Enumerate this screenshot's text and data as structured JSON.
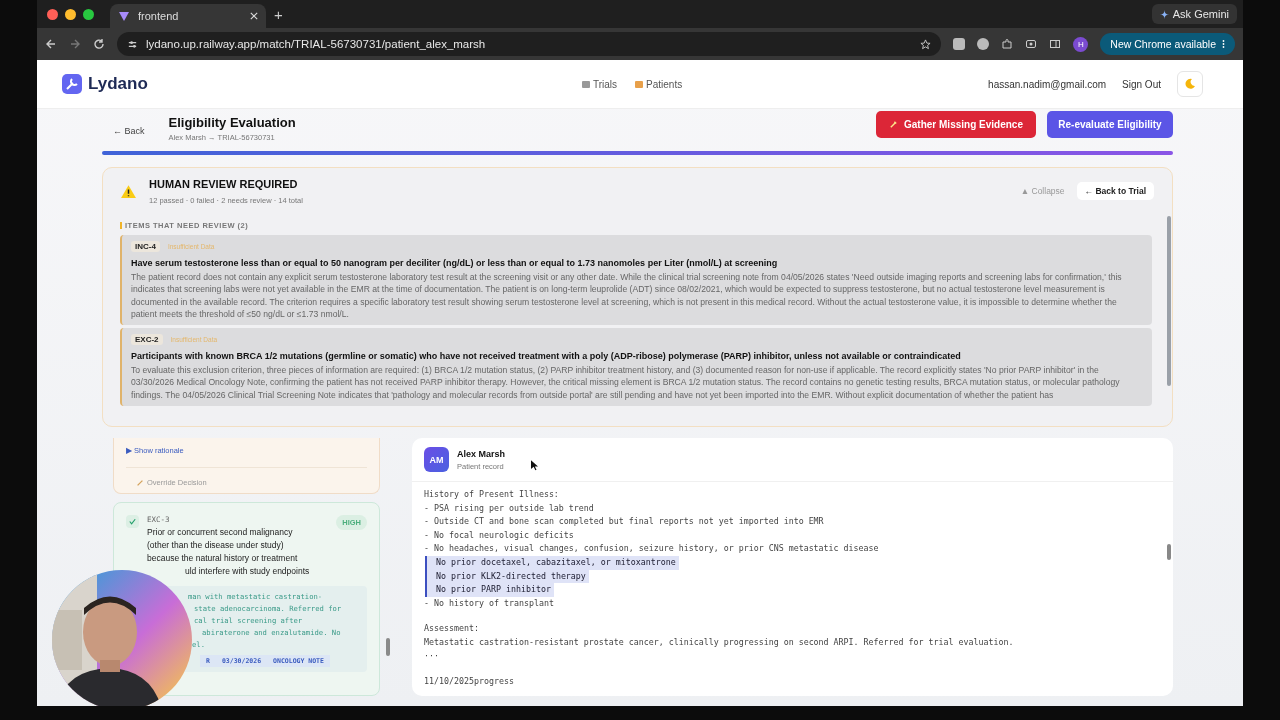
{
  "browser": {
    "tab": {
      "title": "frontend",
      "selected": true
    },
    "new_tab": "+",
    "ask_gemini": "Ask Gemini",
    "url": "lydano.up.railway.app/match/TRIAL-56730731/patient_alex_marsh",
    "profile": "H",
    "update_button": "New Chrome available"
  },
  "header": {
    "logo": "Lydano",
    "nav": [
      {
        "label": "Trials"
      },
      {
        "label": "Patients"
      }
    ],
    "email": "hassan.nadim@gmail.com",
    "sign_out": "Sign Out"
  },
  "subheader": {
    "back": "← Back",
    "title": "Eligibility Evaluation",
    "subtitle": "Alex Marsh → TRIAL-56730731",
    "buttons": [
      {
        "label": "Gather Missing Evidence",
        "kind": "danger"
      },
      {
        "label": "Re-evaluate Eligibility",
        "kind": "primary"
      }
    ]
  },
  "review": {
    "title": "HUMAN REVIEW REQUIRED",
    "summary": "12 passed · 0 failed · 2 needs review · 14 total",
    "collapse": "▲ Collapse",
    "back_to_trial": "← Back to Trial",
    "section_title": "ITEMS THAT NEED REVIEW (2)",
    "items": [
      {
        "code": "INC-4",
        "status": "Insufficient Data",
        "title": "Have serum testosterone less than or equal to 50 nanogram per deciliter (ng/dL) or less than or equal to 1.73 nanomoles per Liter (nmol/L) at screening",
        "body": "The patient record does not contain any explicit serum testosterone laboratory test result at the screening visit or any other date. While the clinical trial screening note from 04/05/2026 states 'Need outside imaging reports and screening labs for confirmation,' this indicates that screening labs were not yet available in the EMR at the time of documentation. The patient is on long-term leuprolide (ADT) since 08/02/2021, which would be expected to suppress testosterone, but no actual testosterone level measurement is documented in the available record. The criterion requires a specific laboratory test result showing serum testosterone level at screening, which is not present in this medical record. Without the actual testosterone value, it is impossible to determine whether the patient meets the threshold of ≤50 ng/dL or ≤1.73 nmol/L."
      },
      {
        "code": "EXC-2",
        "status": "Insufficient Data",
        "title": "Participants with known BRCA 1/2 mutations (germline or somatic) who have not received treatment with a poly (ADP-ribose) polymerase (PARP) inhibitor, unless not available or contraindicated",
        "body": "To evaluate this exclusion criterion, three pieces of information are required: (1) BRCA 1/2 mutation status, (2) PARP inhibitor treatment history, and (3) documented reason for non-use if applicable. The record explicitly states 'No prior PARP inhibitor' in the 03/30/2026 Medical Oncology Note, confirming the patient has not received PARP inhibitor therapy. However, the critical missing element is BRCA 1/2 mutation status. The record contains no genetic testing results, BRCA mutation status, or molecular pathology findings. The 04/05/2026 Clinical Trial Screening Note indicates that 'pathology and molecular records from outside portal' are still pending and have not yet been imported into the EMR. Without explicit documentation of whether the patient has"
      }
    ]
  },
  "criteria_panel": {
    "show_rationale": "▶ Show rationale",
    "override": "Override Decision",
    "criterion": {
      "code": "EXC-3",
      "passed": true,
      "confidence": "HIGH",
      "lines": [
        "Prior or concurrent second malignancy",
        "(other than the disease under study)",
        "because the natural history or treatment",
        "uld interfere with study endpoints"
      ],
      "evidence_lines": [
        "man with metastatic castration-",
        "state adenocarcinoma. Referred for",
        "cal trial screening after",
        "abiraterone and enzalutamide. No",
        "el."
      ],
      "tags": [
        "R",
        "03/30/2026",
        "ONCOLOGY NOTE"
      ]
    }
  },
  "record": {
    "initials": "AM",
    "name": "Alex Marsh",
    "subtitle": "Patient record",
    "lines": [
      {
        "kind": "line",
        "text": "History of Present Illness:",
        "highlighted": false
      },
      {
        "kind": "line",
        "text": "- PSA rising per outside lab trend",
        "highlighted": false
      },
      {
        "kind": "line",
        "text": "- Outside CT and bone scan completed but final reports not yet imported into EMR",
        "highlighted": false
      },
      {
        "kind": "line",
        "text": "- No focal neurologic deficits",
        "highlighted": false
      },
      {
        "kind": "line",
        "text": "- No headaches, visual changes, confusion, seizure history, or prior CNS metastatic disease",
        "highlighted": false
      },
      {
        "kind": "line",
        "text": "No prior docetaxel, cabazitaxel, or mitoxantrone",
        "highlighted": true
      },
      {
        "kind": "line",
        "text": "No prior KLK2-directed therapy",
        "highlighted": true
      },
      {
        "kind": "line",
        "text": "No prior PARP inhibitor",
        "highlighted": true
      },
      {
        "kind": "line",
        "text": "- No history of transplant",
        "highlighted": false
      },
      {
        "kind": "spacer"
      },
      {
        "kind": "line",
        "text": "Assessment:",
        "highlighted": false
      },
      {
        "kind": "line",
        "text": "Metastatic castration-resistant prostate cancer, clinically progressing on second ARPI. Referred for trial evaluation.",
        "highlighted": false
      },
      {
        "kind": "line",
        "text": "···",
        "highlighted": false
      },
      {
        "kind": "spacer"
      },
      {
        "kind": "line",
        "text": "11/10/2025progress",
        "highlighted": false
      }
    ]
  }
}
